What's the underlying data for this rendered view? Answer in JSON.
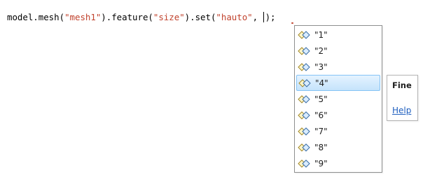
{
  "editor": {
    "code": {
      "p1": "model.mesh(",
      "s1": "\"mesh1\"",
      "p2": ").feature(",
      "s2": "\"size\"",
      "p3": ").set(",
      "s3": "\"hauto\"",
      "p4": ", ",
      "p5": ");"
    }
  },
  "completion": {
    "items": [
      {
        "label": "\"1\"",
        "icon": "value-item-icon"
      },
      {
        "label": "\"2\"",
        "icon": "value-item-icon"
      },
      {
        "label": "\"3\"",
        "icon": "value-item-icon"
      },
      {
        "label": "\"4\"",
        "icon": "value-item-icon",
        "selected": true
      },
      {
        "label": "\"5\"",
        "icon": "value-item-icon"
      },
      {
        "label": "\"6\"",
        "icon": "value-item-icon"
      },
      {
        "label": "\"7\"",
        "icon": "value-item-icon"
      },
      {
        "label": "\"8\"",
        "icon": "value-item-icon"
      },
      {
        "label": "\"9\"",
        "icon": "value-item-icon"
      }
    ]
  },
  "info_tip": {
    "title": "Fine",
    "help_link": "Help"
  },
  "colors": {
    "string": "#c1432e",
    "selection_border": "#84c3f5",
    "link": "#1f5fbf"
  }
}
